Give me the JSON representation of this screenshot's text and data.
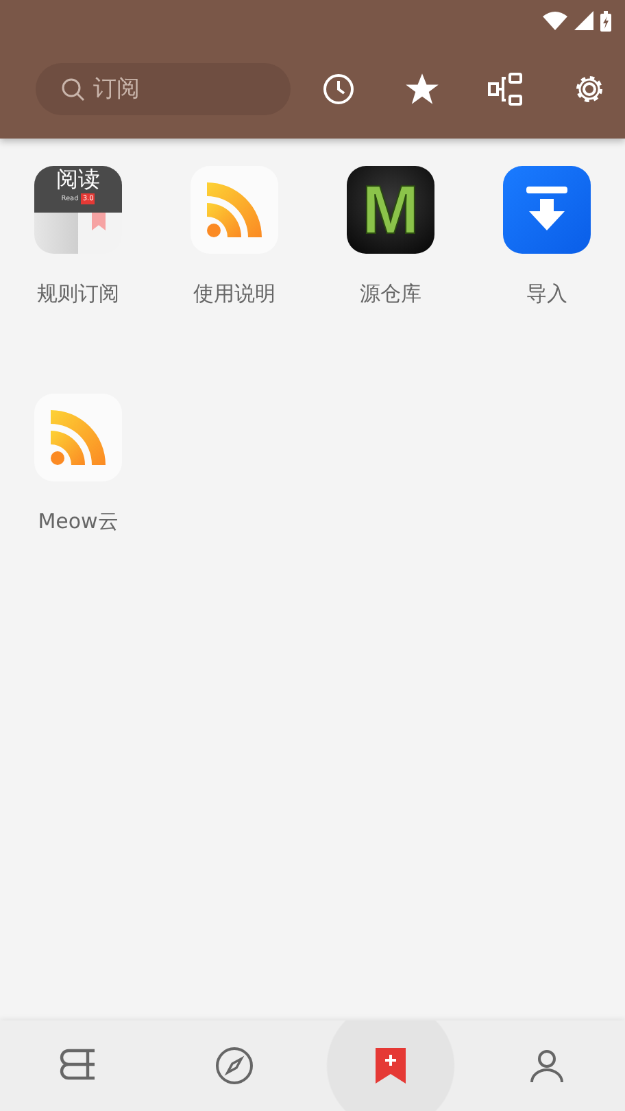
{
  "search": {
    "placeholder": "订阅"
  },
  "toolbar": [
    {
      "kind": "history"
    },
    {
      "kind": "star"
    },
    {
      "kind": "rules"
    },
    {
      "kind": "settings"
    }
  ],
  "sources": [
    {
      "label": "规则订阅",
      "kind": "book",
      "icon_text": "阅读",
      "icon_subtext": "Read",
      "icon_badge": "3.0"
    },
    {
      "label": "使用说明",
      "kind": "rss"
    },
    {
      "label": "源仓库",
      "kind": "letter",
      "icon_text": "M"
    },
    {
      "label": "导入",
      "kind": "import"
    },
    {
      "label": "Meow云",
      "kind": "rss"
    }
  ],
  "bottom_nav": [
    {
      "kind": "bookshelf",
      "selected": false
    },
    {
      "kind": "explore",
      "selected": false
    },
    {
      "kind": "rss",
      "selected": true
    },
    {
      "kind": "profile",
      "selected": false
    }
  ]
}
